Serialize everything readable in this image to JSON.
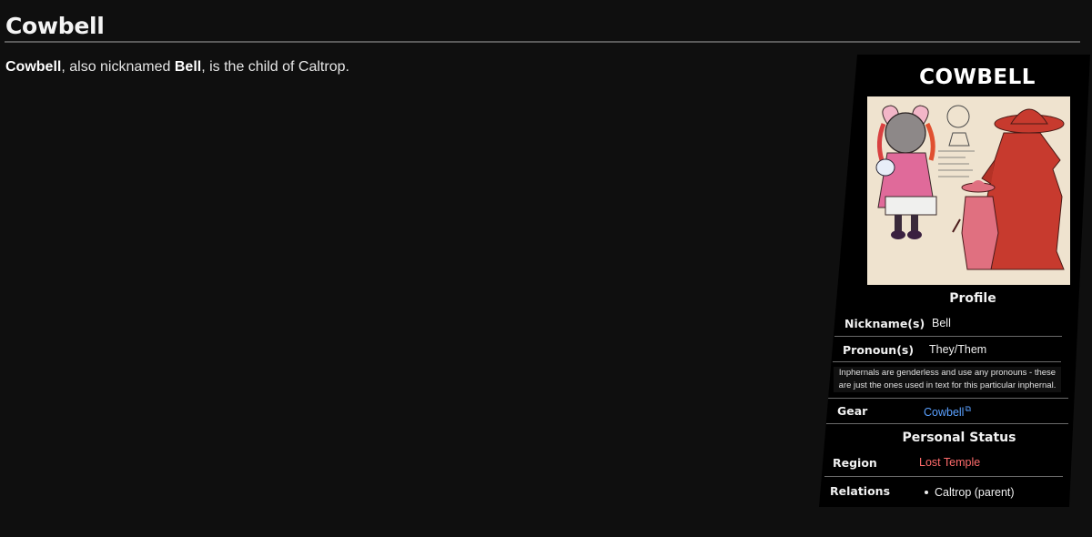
{
  "page": {
    "title": "Cowbell",
    "intro": {
      "name": "Cowbell",
      "text1": ", also nicknamed ",
      "nickname": "Bell",
      "text2": ", is the child of Caltrop."
    }
  },
  "infobox": {
    "title": "COWBELL",
    "image_alt": "Cowbell character art",
    "sections": {
      "profile": "Profile",
      "personal_status": "Personal Status"
    },
    "rows": {
      "nicknames": {
        "label": "Nickname(s)",
        "value": "Bell"
      },
      "pronouns": {
        "label": "Pronoun(s)",
        "value": "They/Them"
      },
      "pronoun_note": "Inphernals are genderless and use any pronouns - these are just the ones used in text for this particular inphernal.",
      "gear": {
        "label": "Gear",
        "value": "Cowbell"
      },
      "region": {
        "label": "Region",
        "value": "Lost Temple"
      },
      "relations": {
        "label": "Relations",
        "items": [
          "Caltrop (parent)"
        ]
      }
    },
    "icons": {
      "external_link": "external-link-icon"
    },
    "colors": {
      "link": "#5aa0ff",
      "region_link": "#ff6b6b"
    }
  }
}
